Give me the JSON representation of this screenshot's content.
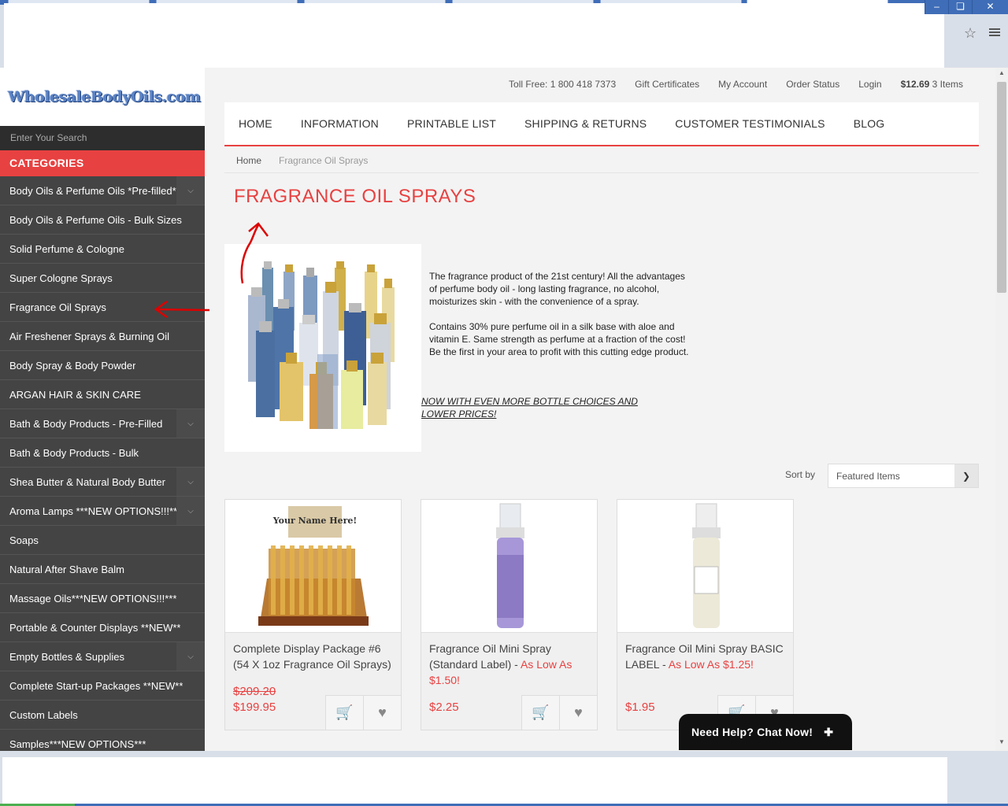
{
  "sidebar": {
    "logo": "WholesaleBodyOils.com",
    "search_placeholder": "Enter Your Search",
    "categories_heading": "CATEGORIES",
    "items": [
      {
        "label": "Body Oils & Perfume Oils *Pre-filled*",
        "expandable": true
      },
      {
        "label": "Body Oils & Perfume Oils - Bulk Sizes",
        "expandable": false
      },
      {
        "label": "Solid Perfume & Cologne",
        "expandable": false
      },
      {
        "label": "Super Cologne Sprays",
        "expandable": false
      },
      {
        "label": "Fragrance Oil Sprays",
        "expandable": false
      },
      {
        "label": "Air Freshener Sprays & Burning Oil",
        "expandable": false
      },
      {
        "label": "Body Spray & Body Powder",
        "expandable": false
      },
      {
        "label": "ARGAN HAIR & SKIN CARE",
        "expandable": false
      },
      {
        "label": "Bath & Body Products - Pre-Filled",
        "expandable": true
      },
      {
        "label": "Bath & Body Products - Bulk",
        "expandable": false
      },
      {
        "label": "Shea Butter & Natural Body Butter",
        "expandable": true
      },
      {
        "label": "Aroma Lamps ***NEW OPTIONS!!!***",
        "expandable": true
      },
      {
        "label": "Soaps",
        "expandable": false
      },
      {
        "label": "Natural After Shave Balm",
        "expandable": false
      },
      {
        "label": "Massage Oils***NEW OPTIONS!!!***",
        "expandable": false
      },
      {
        "label": "Portable & Counter Displays **NEW**",
        "expandable": false
      },
      {
        "label": "Empty Bottles & Supplies",
        "expandable": true
      },
      {
        "label": "Complete Start-up Packages **NEW**",
        "expandable": false
      },
      {
        "label": "Custom Labels",
        "expandable": false
      },
      {
        "label": "Samples***NEW OPTIONS***",
        "expandable": false
      }
    ]
  },
  "topbar": {
    "toll_free": "Toll Free: 1 800 418 7373",
    "gift": "Gift Certificates",
    "account": "My Account",
    "order_status": "Order Status",
    "login": "Login",
    "cart_total": "$12.69",
    "cart_items": "3 Items"
  },
  "nav": [
    "HOME",
    "INFORMATION",
    "PRINTABLE LIST",
    "SHIPPING & RETURNS",
    "CUSTOMER TESTIMONIALS",
    "BLOG"
  ],
  "breadcrumb": {
    "home": "Home",
    "current": "Fragrance Oil Sprays"
  },
  "page_title": "FRAGRANCE OIL SPRAYS",
  "description": {
    "p1": "The fragrance product of the 21st century! All the advantages of perfume body oil - long lasting fragrance, no alcohol, moisturizes skin - with the convenience of a spray.",
    "p2": "Contains 30% pure perfume oil in a silk base with aloe and vitamin E. Same strength as perfume at a fraction of the cost! Be the first in your area to profit with this cutting edge product.",
    "promo": "NOW WITH EVEN MORE BOTTLE CHOICES AND LOWER PRICES!"
  },
  "sort": {
    "label": "Sort by",
    "value": "Featured Items"
  },
  "products": [
    {
      "name": "Complete Display Package #6 (54 X 1oz Fragrance Oil Sprays)",
      "suffix": "",
      "old_price": "$209.20",
      "price": "$199.95"
    },
    {
      "name": "Fragrance Oil Mini Spray (Standard Label) - ",
      "suffix": "As Low As $1.50!",
      "old_price": "",
      "price": "$2.25"
    },
    {
      "name": "Fragrance Oil Mini Spray BASIC LABEL - ",
      "suffix": "As Low As $1.25!",
      "old_price": "",
      "price": "$1.95"
    }
  ],
  "product_image_text": {
    "display_sign": "Your Name Here!"
  },
  "chat": "Need Help? Chat Now!",
  "colors": {
    "accent": "#e84141",
    "sidebar": "#444444",
    "annotation": "#dd0000"
  }
}
